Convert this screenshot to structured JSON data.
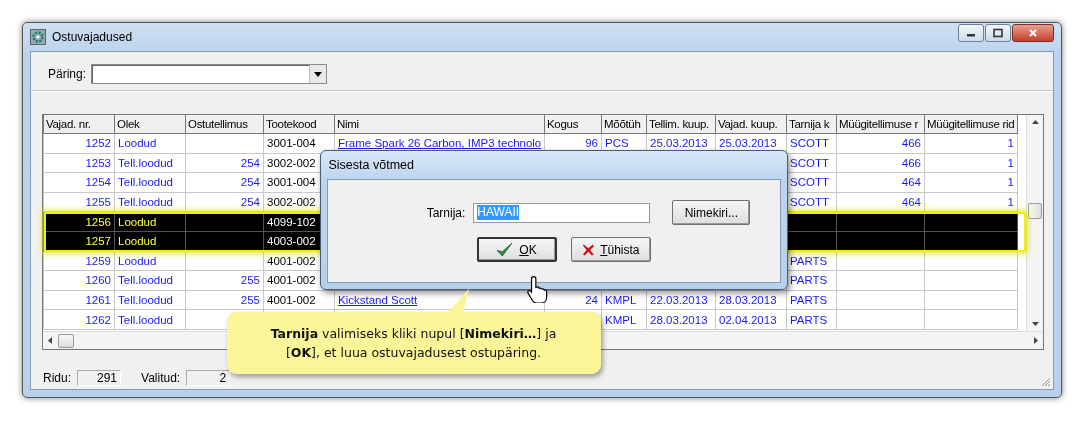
{
  "window": {
    "title": "Ostuvajadused"
  },
  "query": {
    "label": "Päring:"
  },
  "table": {
    "columns": [
      "Vajad. nr.",
      "Olek",
      "Ostutellimus",
      "Tootekood",
      "Nimi",
      "Kogus",
      "Mõõtüh",
      "Tellim. kuup.",
      "Vajad. kuup.",
      "Tarnija k",
      "Müügitellimuse r",
      "Müügitellimuse rid"
    ],
    "rows": [
      {
        "selected": false,
        "cells": [
          "1252",
          "Loodud",
          null,
          "3001-004",
          "Frame Spark 26 Carbon, IMP3 technolo",
          "96",
          "PCS",
          "25.03.2013",
          "25.03.2013",
          "SCOTT",
          "466",
          "1"
        ]
      },
      {
        "selected": false,
        "cells": [
          "1253",
          "Tell.loodud",
          "254",
          "3002-002",
          null,
          null,
          null,
          null,
          null,
          "SCOTT",
          "466",
          "1"
        ]
      },
      {
        "selected": false,
        "cells": [
          "1254",
          "Tell.loodud",
          "254",
          "3001-004",
          null,
          null,
          null,
          null,
          null,
          "SCOTT",
          "464",
          "1"
        ]
      },
      {
        "selected": false,
        "cells": [
          "1255",
          "Tell.loodud",
          "254",
          "3002-002",
          null,
          null,
          null,
          null,
          null,
          "SCOTT",
          "464",
          "1"
        ]
      },
      {
        "selected": true,
        "cells": [
          "1256",
          "Loodud",
          null,
          "4099-102",
          null,
          null,
          null,
          null,
          null,
          null,
          null,
          null
        ]
      },
      {
        "selected": true,
        "cells": [
          "1257",
          "Loodud",
          null,
          "4003-002",
          null,
          null,
          null,
          null,
          null,
          null,
          null,
          null
        ]
      },
      {
        "selected": false,
        "cells": [
          "1259",
          "Loodud",
          null,
          "4001-002",
          null,
          null,
          null,
          null,
          null,
          "PARTS",
          null,
          null
        ]
      },
      {
        "selected": false,
        "cells": [
          "1260",
          "Tell.loodud",
          "255",
          "4001-002",
          null,
          null,
          null,
          null,
          null,
          "PARTS",
          null,
          null
        ]
      },
      {
        "selected": false,
        "cells": [
          "1261",
          "Tell.loodud",
          "255",
          "4001-002",
          "Kickstand Scott",
          "24",
          "KMPL",
          "22.03.2013",
          "28.03.2013",
          "PARTS",
          null,
          null
        ]
      },
      {
        "selected": false,
        "cells": [
          "1262",
          "Tell.loodud",
          null,
          null,
          null,
          null,
          "KMPL",
          "28.03.2013",
          "02.04.2013",
          "PARTS",
          null,
          null
        ]
      }
    ]
  },
  "dialog": {
    "title": "Sisesta võtmed",
    "field_label": "Tarnija:",
    "field_value": "HAWAII",
    "buttons": [
      {
        "kind": "list",
        "label": "Nimekiri..."
      },
      {
        "kind": "ok",
        "label": "OK"
      },
      {
        "kind": "cancel",
        "label": "Tühista"
      }
    ]
  },
  "callout": {
    "text": "**Tarnija** valimiseks kliki nupul [**Nimekiri…**] ja [**OK**], et luua ostuvajadusest ostupäring."
  },
  "status_bar": [
    {
      "label": "Ridu:",
      "value": "291"
    },
    {
      "label": "Valitud:",
      "value": "2"
    }
  ]
}
